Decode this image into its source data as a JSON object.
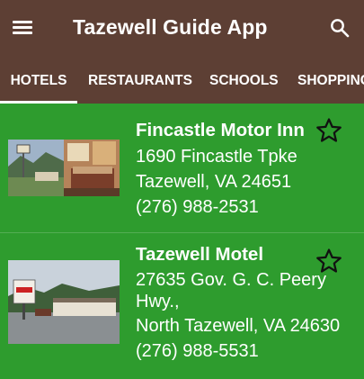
{
  "app": {
    "title": "Tazewell Guide App"
  },
  "colors": {
    "appbar": "#5d3f34",
    "list_background": "#2e9c2e",
    "text": "#ffffff"
  },
  "icons": {
    "menu": "menu-icon",
    "search": "search-icon",
    "favorite": "star-outline-icon"
  },
  "tabs": [
    {
      "label": "HOTELS",
      "selected": true
    },
    {
      "label": "RESTAURANTS",
      "selected": false
    },
    {
      "label": "SCHOOLS",
      "selected": false
    },
    {
      "label": "SHOPPING",
      "selected": false
    }
  ],
  "listings": [
    {
      "name": "Fincastle Motor Inn",
      "address_line1": "1690 Fincastle Tpke",
      "address_line2": "Tazewell, VA 24651",
      "phone": "(276) 988-2531"
    },
    {
      "name": "Tazewell Motel",
      "address_line1": "27635 Gov. G. C. Peery",
      "address_line1b": "Hwy.,",
      "address_line2": "North Tazewell, VA 24630",
      "phone": "(276) 988-5531"
    }
  ]
}
